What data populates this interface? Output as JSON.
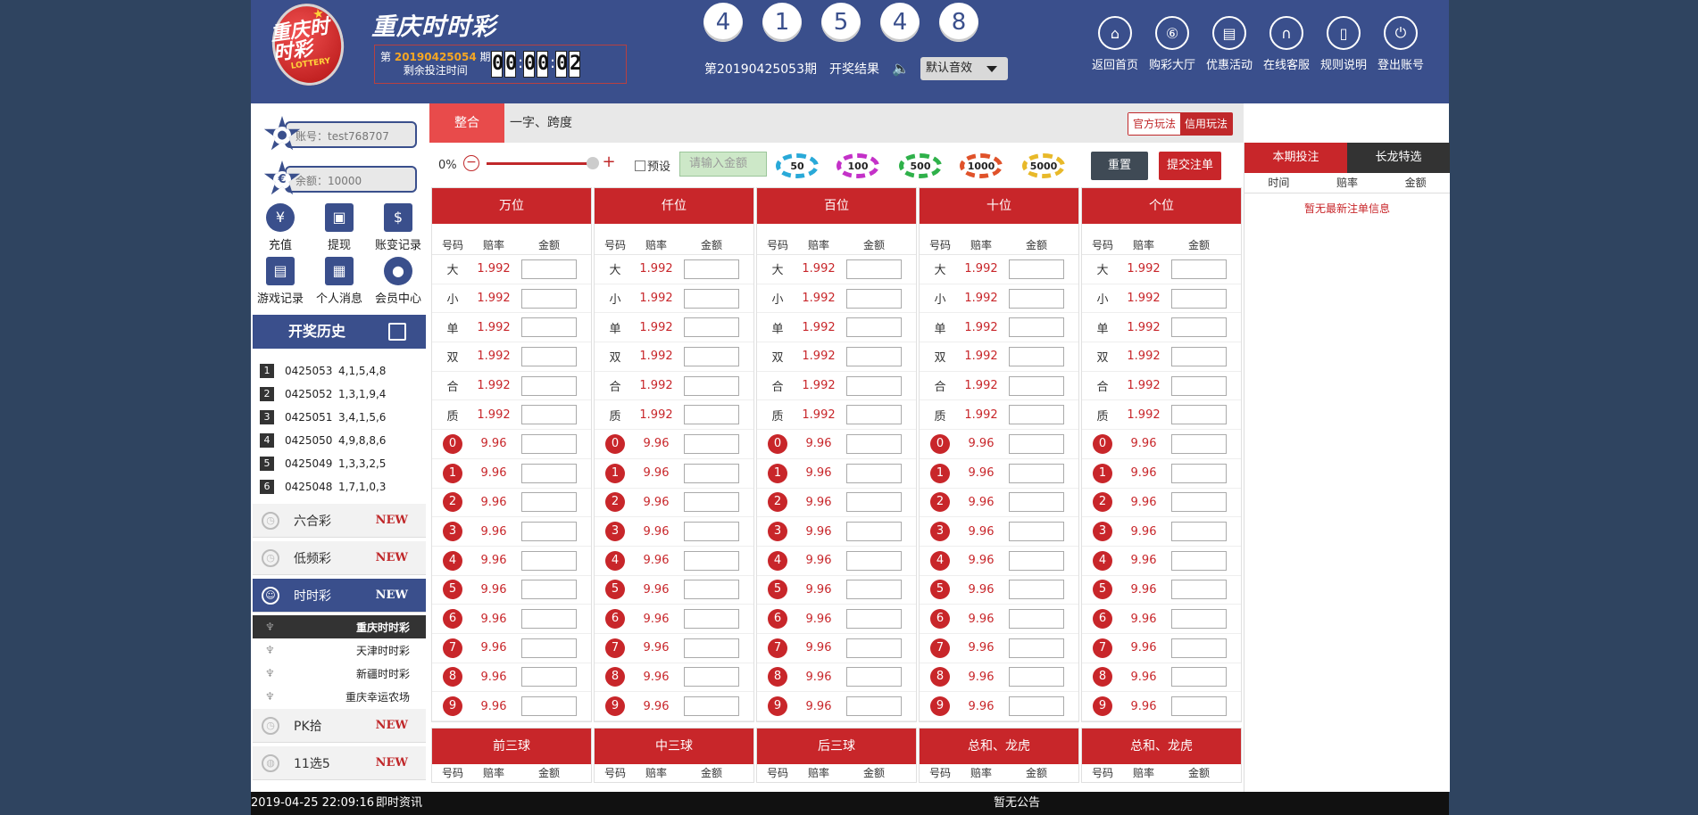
{
  "header": {
    "logo_text": "重庆时时彩",
    "logo_sub": "LOTTERY",
    "game_title": "重庆时时彩",
    "period_prefix": "第",
    "period_number": "20190425054",
    "period_suffix": "期",
    "countdown_label": "剩余投注时间",
    "countdown": [
      "0",
      "0",
      "0",
      "0",
      "0",
      "2"
    ],
    "result_balls": [
      "4",
      "1",
      "5",
      "4",
      "8"
    ],
    "result_period": "第20190425053期",
    "result_label": "开奖结果",
    "sound_option": "默认音效",
    "nav": [
      {
        "label": "返回首页",
        "icon": "home-icon"
      },
      {
        "label": "购彩大厅",
        "icon": "lottery-hall-icon"
      },
      {
        "label": "优惠活动",
        "icon": "promotion-icon"
      },
      {
        "label": "在线客服",
        "icon": "headset-icon"
      },
      {
        "label": "规则说明",
        "icon": "rules-icon"
      },
      {
        "label": "登出账号",
        "icon": "power-icon"
      }
    ]
  },
  "sidebar": {
    "account": "账号：test768707",
    "balance": "余额：10000",
    "quick": [
      {
        "label": "充值",
        "icon": "yen-icon"
      },
      {
        "label": "提现",
        "icon": "withdraw-icon"
      },
      {
        "label": "账变记录",
        "icon": "ledger-icon"
      },
      {
        "label": "游戏记录",
        "icon": "game-record-icon"
      },
      {
        "label": "个人消息",
        "icon": "message-icon"
      },
      {
        "label": "会员中心",
        "icon": "member-icon"
      }
    ],
    "history_title": "开奖历史",
    "history": [
      {
        "rank": "1",
        "period": "0425053",
        "nums": "4,1,5,4,8"
      },
      {
        "rank": "2",
        "period": "0425052",
        "nums": "1,3,1,9,4"
      },
      {
        "rank": "3",
        "period": "0425051",
        "nums": "3,4,1,5,6"
      },
      {
        "rank": "4",
        "period": "0425050",
        "nums": "4,9,8,8,6"
      },
      {
        "rank": "5",
        "period": "0425049",
        "nums": "1,3,3,2,5"
      },
      {
        "rank": "6",
        "period": "0425048",
        "nums": "1,7,1,0,3"
      }
    ],
    "lotteries": [
      {
        "label": "六合彩",
        "badge": "NEW"
      },
      {
        "label": "低频彩",
        "badge": "NEW"
      },
      {
        "label": "时时彩",
        "badge": "NEW"
      },
      {
        "label": "PK拾",
        "badge": "NEW"
      },
      {
        "label": "11选5",
        "badge": "NEW"
      }
    ],
    "sub_items": [
      "重庆时时彩",
      "天津时时彩",
      "新疆时时彩",
      "重庆幸运农场"
    ]
  },
  "main": {
    "tabs": [
      "整合",
      "一字、跨度"
    ],
    "modes": [
      "官方玩法",
      "信用玩法"
    ],
    "slider_pct": "0%",
    "preset_label": "预设",
    "amount_placeholder": "请输入金额",
    "chips": [
      "50",
      "100",
      "500",
      "1000",
      "5000"
    ],
    "reset_label": "重置",
    "submit_label": "提交注单",
    "sub_headers": [
      "号码",
      "赔率",
      "金额"
    ],
    "positions": [
      "万位",
      "仟位",
      "百位",
      "十位",
      "个位"
    ],
    "bet_rows": [
      {
        "key": "大",
        "odds": "1.992"
      },
      {
        "key": "小",
        "odds": "1.992"
      },
      {
        "key": "单",
        "odds": "1.992"
      },
      {
        "key": "双",
        "odds": "1.992"
      },
      {
        "key": "合",
        "odds": "1.992"
      },
      {
        "key": "质",
        "odds": "1.992"
      },
      {
        "key": "0",
        "odds": "9.96"
      },
      {
        "key": "1",
        "odds": "9.96"
      },
      {
        "key": "2",
        "odds": "9.96"
      },
      {
        "key": "3",
        "odds": "9.96"
      },
      {
        "key": "4",
        "odds": "9.96"
      },
      {
        "key": "5",
        "odds": "9.96"
      },
      {
        "key": "6",
        "odds": "9.96"
      },
      {
        "key": "7",
        "odds": "9.96"
      },
      {
        "key": "8",
        "odds": "9.96"
      },
      {
        "key": "9",
        "odds": "9.96"
      }
    ],
    "lower_sections": [
      "前三球",
      "中三球",
      "后三球",
      "总和、龙虎",
      "总和、龙虎"
    ]
  },
  "right_panel": {
    "tabs": [
      "本期投注",
      "长龙特选"
    ],
    "headers": [
      "时间",
      "赔率",
      "金额"
    ],
    "empty": "暂无最新注单信息"
  },
  "footer": {
    "datetime": "2019-04-25 22:09:16",
    "news": "即时资讯",
    "notice": "暂无公告"
  },
  "colors": {
    "brand": "#3a4f8c",
    "accent": "#c8262a",
    "page_bg": "#2f4460"
  }
}
